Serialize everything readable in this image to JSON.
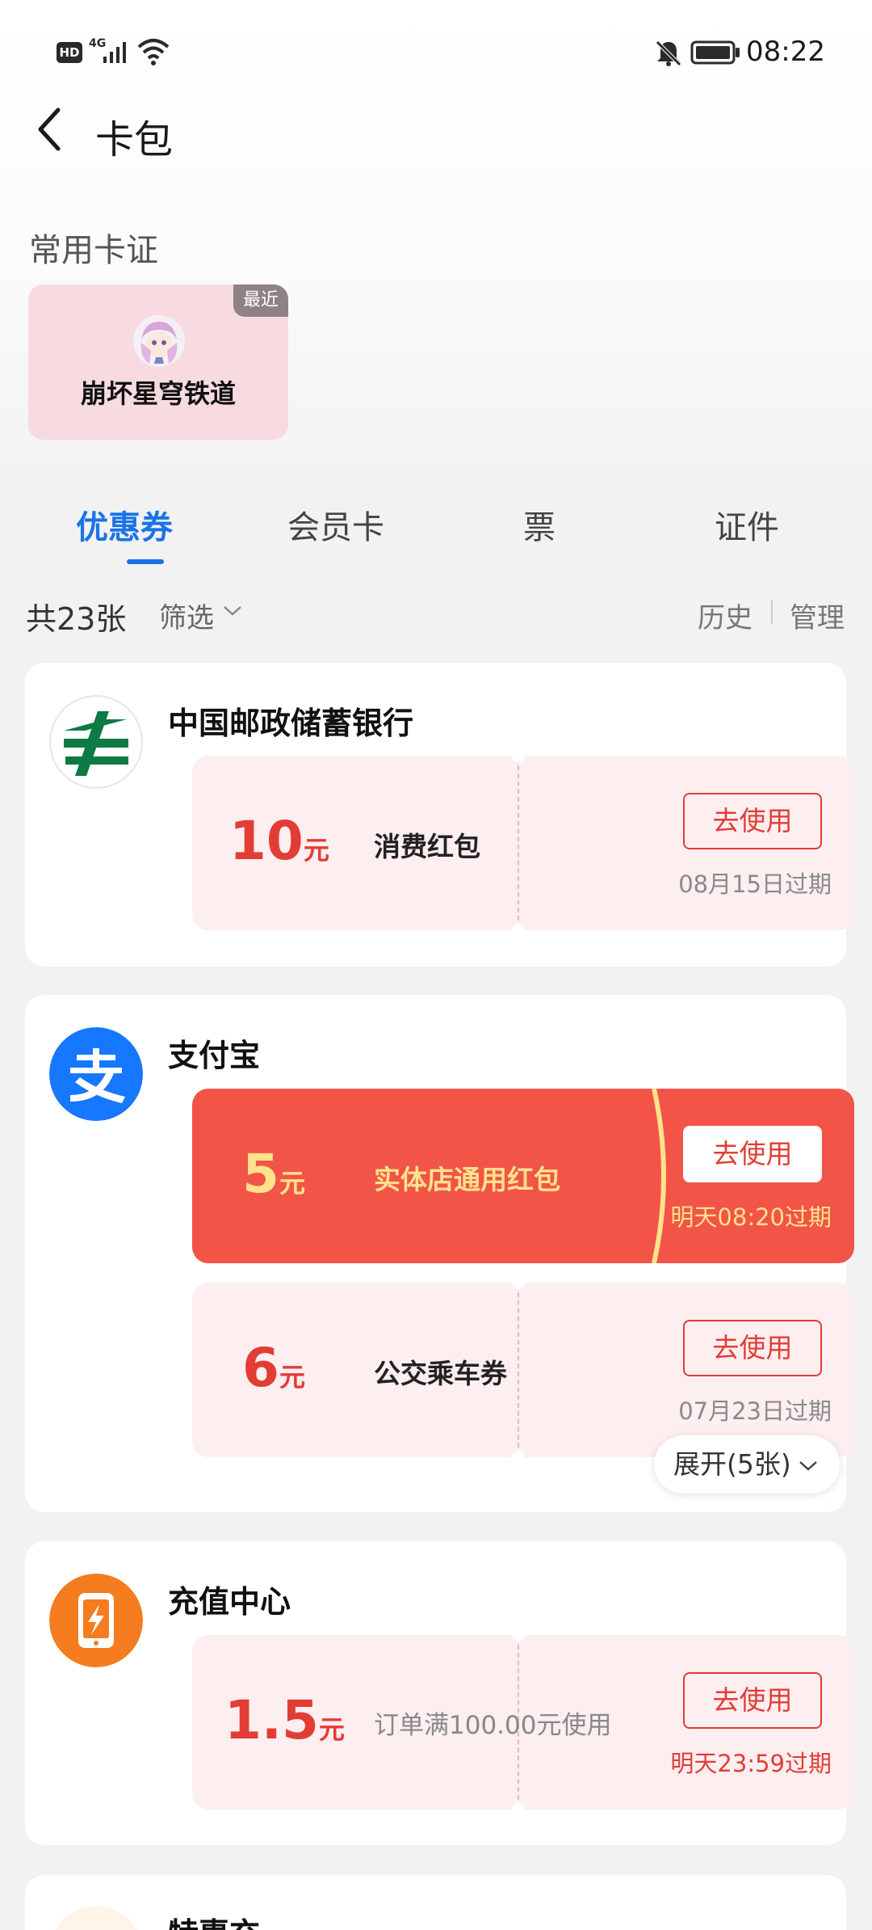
{
  "status_bar": {
    "hd": "HD",
    "network": "4G",
    "time": "08:22",
    "icons": [
      "signal-icon",
      "wifi-icon",
      "mute-bell-icon",
      "battery-icon"
    ]
  },
  "header": {
    "title": "卡包",
    "back_icon": "chevron-left-icon"
  },
  "favorites": {
    "label": "常用卡证",
    "card": {
      "name": "崩坏星穹铁道",
      "badge": "最近"
    }
  },
  "tabs": [
    {
      "label": "优惠券",
      "active": true
    },
    {
      "label": "会员卡",
      "active": false
    },
    {
      "label": "票",
      "active": false
    },
    {
      "label": "证件",
      "active": false
    }
  ],
  "filter_row": {
    "count": "共23张",
    "filter": "筛选",
    "history": "历史",
    "manage": "管理"
  },
  "merchants": [
    {
      "name": "中国邮政储蓄银行",
      "coupons": [
        {
          "amount": "10",
          "unit": "元",
          "title": "消费红包",
          "button": "去使用",
          "expire": "08月15日过期"
        }
      ]
    },
    {
      "name": "支付宝",
      "coupons": [
        {
          "amount": "5",
          "unit": "元",
          "title": "实体店通用红包",
          "button": "去使用",
          "expire": "明天08:20过期",
          "featured": true
        },
        {
          "amount": "6",
          "unit": "元",
          "title": "公交乘车券",
          "button": "去使用",
          "expire": "07月23日过期"
        }
      ],
      "expand": "展开(5张)"
    },
    {
      "name": "充值中心",
      "coupons": [
        {
          "amount": "1.5",
          "unit": "元",
          "title": "订单满100.00元使用",
          "button": "去使用",
          "expire": "明天23:59过期"
        }
      ]
    },
    {
      "name": "特惠充"
    }
  ],
  "colors": {
    "accent": "#1a73e8",
    "coupon_red": "#e23d35",
    "featured_bg": "#f25448",
    "featured_text": "#ffe28a",
    "coupon_bg": "#fdeef0",
    "favorite_card_bg": "#f7dbe1"
  }
}
